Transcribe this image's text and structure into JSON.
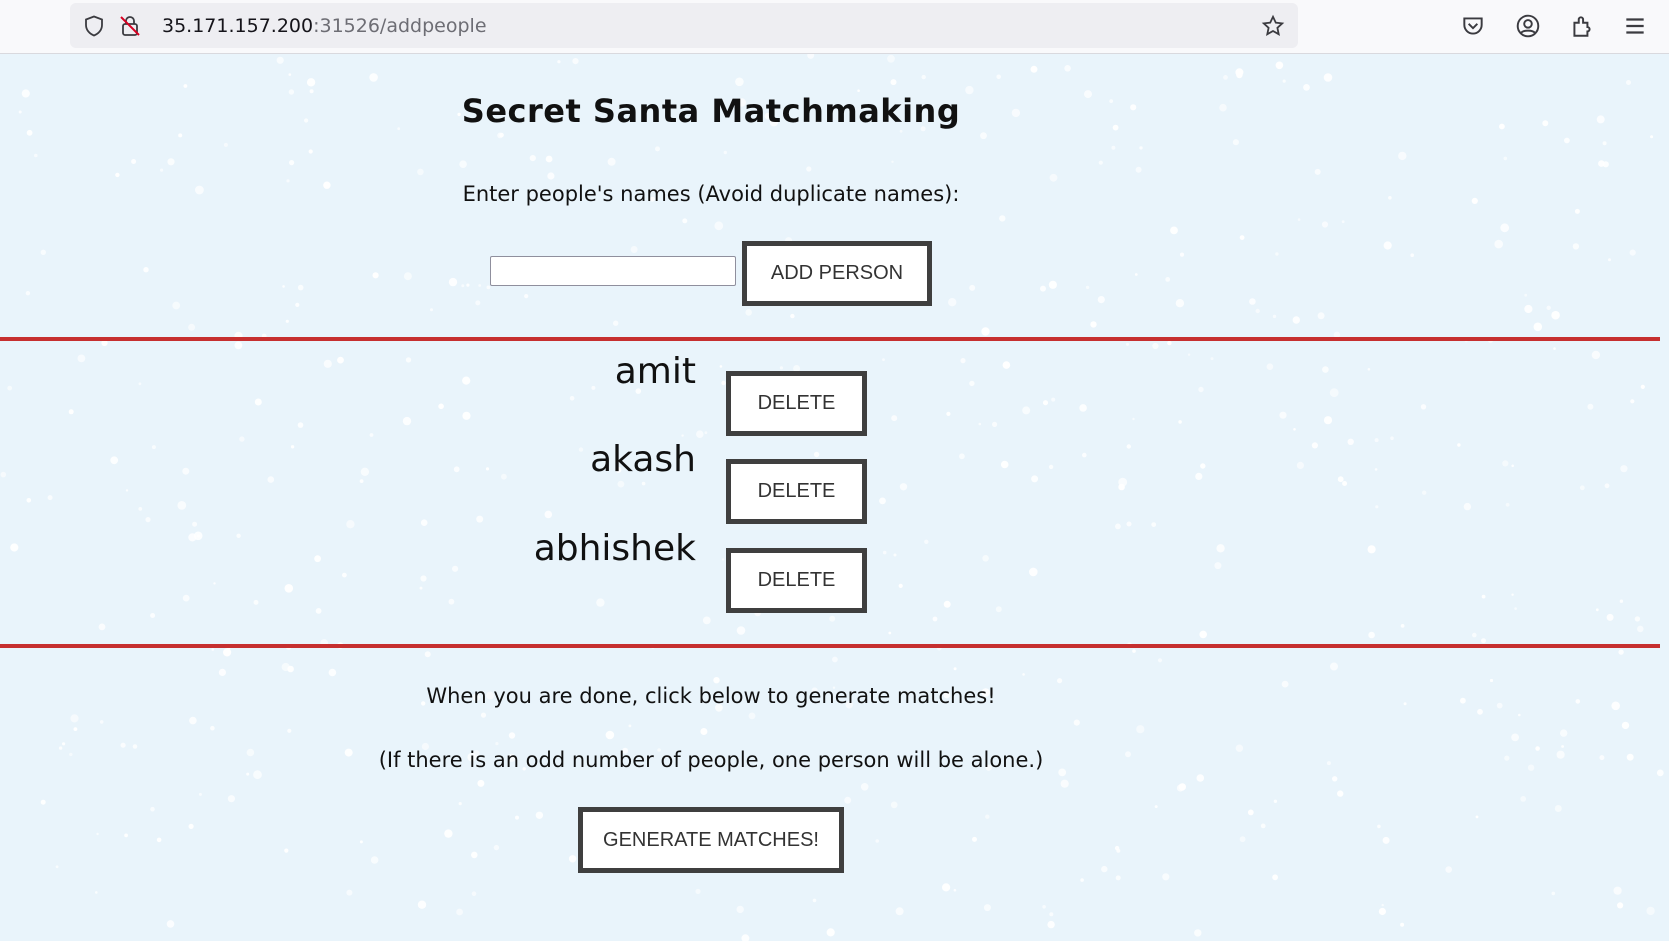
{
  "browser": {
    "url_host": "35.171.157.200",
    "url_path": ":31526/addpeople"
  },
  "page": {
    "title": "Secret Santa Matchmaking",
    "instructions": "Enter people's names (Avoid duplicate names):",
    "name_input": {
      "value": "",
      "placeholder": ""
    },
    "add_person_label": "ADD PERSON",
    "people": [
      {
        "name": "amit",
        "delete_label": "DELETE"
      },
      {
        "name": "akash",
        "delete_label": "DELETE"
      },
      {
        "name": "abhishek",
        "delete_label": "DELETE"
      }
    ],
    "done_text": "When you are done, click below to generate matches!",
    "odd_note": "(If there is an odd number of people, one person will be alone.)",
    "generate_label": "GENERATE MATCHES!"
  },
  "colors": {
    "page_bg": "#e9f4fb",
    "divider": "#c62f2f",
    "button_border": "#3f3f3f",
    "snow": "#ffffff"
  }
}
